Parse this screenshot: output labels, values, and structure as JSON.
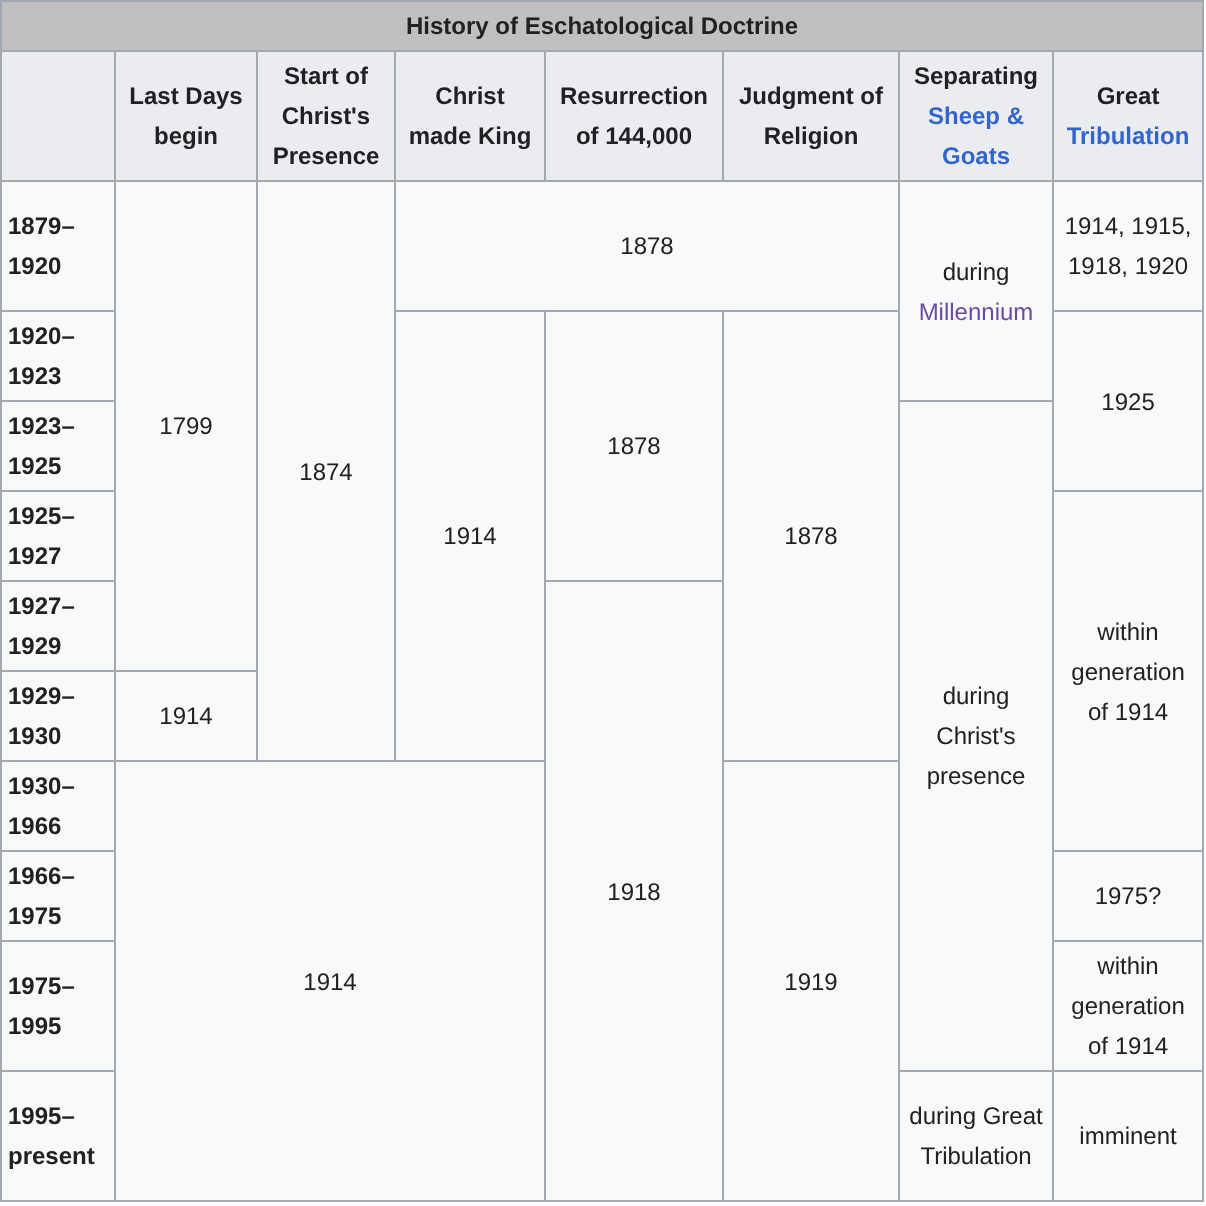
{
  "table": {
    "title": "History of Eschatological Doctrine",
    "columns": [
      {
        "label": "Last Days begin"
      },
      {
        "label": "Start of Christ's Presence"
      },
      {
        "label": "Christ made King"
      },
      {
        "label": "Resurrection of 144,000"
      },
      {
        "label": "Judgment of Religion"
      },
      {
        "label": "Separating",
        "link": "Sheep & Goats"
      },
      {
        "label": "Great",
        "link": "Tribulation"
      }
    ],
    "rows": [
      {
        "header": "1879–1920",
        "cells": [
          {
            "text": "1799",
            "rowspan": 5
          },
          {
            "text": "1874",
            "rowspan": 6
          },
          {
            "text": "1878",
            "colspan": 3
          },
          {
            "text": "during",
            "link": "Millennium",
            "visited": true,
            "rowspan": 2
          },
          {
            "text": "1914, 1915, 1918, 1920"
          }
        ]
      },
      {
        "header": "1920–1923",
        "cells": [
          {
            "text": "1914",
            "rowspan": 5
          },
          {
            "text": "1878",
            "rowspan": 3
          },
          {
            "text": "1878",
            "rowspan": 5
          },
          {
            "text": "1925",
            "rowspan": 2
          }
        ]
      },
      {
        "header": "1923–1925",
        "cells": [
          {
            "text": "during Christ's presence",
            "rowspan": 7
          }
        ]
      },
      {
        "header": "1925–1927",
        "cells": [
          {
            "text": "within generation of 1914",
            "rowspan": 4
          }
        ]
      },
      {
        "header": "1927–1929",
        "cells": [
          {
            "text": "1918",
            "rowspan": 6
          }
        ]
      },
      {
        "header": "1929–1930",
        "cells": [
          {
            "text": "1914"
          }
        ]
      },
      {
        "header": "1930–1966",
        "cells": [
          {
            "text": "1914",
            "colspan": 3,
            "rowspan": 4
          },
          {
            "text": "1919",
            "rowspan": 4
          }
        ]
      },
      {
        "header": "1966–1975",
        "cells": [
          {
            "text": "1975?"
          }
        ]
      },
      {
        "header": "1975–1995",
        "cells": [
          {
            "text": "within generation of 1914"
          }
        ]
      },
      {
        "header": "1995–present",
        "cells": [
          {
            "text": "during Great Tribulation"
          },
          {
            "text": "imminent"
          }
        ]
      }
    ]
  }
}
